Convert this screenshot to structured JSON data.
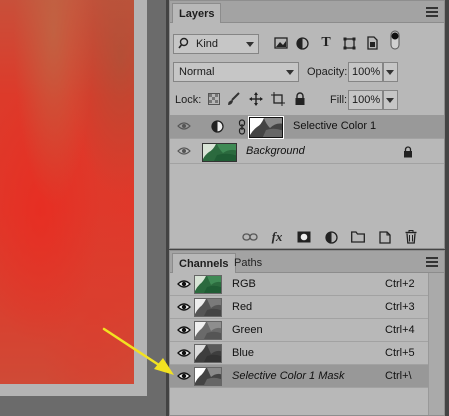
{
  "layers_panel": {
    "tab": "Layers",
    "filter_kind": "Kind",
    "blend_mode": "Normal",
    "opacity_label": "Opacity:",
    "opacity_value": "100%",
    "lock_label": "Lock:",
    "fill_label": "Fill:",
    "fill_value": "100%",
    "layers": [
      {
        "name": "Selective Color 1",
        "selected": true
      },
      {
        "name": "Background",
        "selected": false,
        "locked": true
      }
    ]
  },
  "channels_panel": {
    "tabs": [
      "Channels",
      "Paths"
    ],
    "channels": [
      {
        "name": "RGB",
        "shortcut": "Ctrl+2"
      },
      {
        "name": "Red",
        "shortcut": "Ctrl+3"
      },
      {
        "name": "Green",
        "shortcut": "Ctrl+4"
      },
      {
        "name": "Blue",
        "shortcut": "Ctrl+5"
      },
      {
        "name": "Selective Color 1 Mask",
        "shortcut": "Ctrl+\\",
        "selected": true
      }
    ]
  },
  "colors": {
    "panel_bg": "#b8b8b8",
    "selected_row": "#999999",
    "arrow": "#f2e221",
    "canvas_red": "#e0382a"
  },
  "icons": [
    "search-icon",
    "pixel-filter-icon",
    "adjustment-filter-icon",
    "type-filter-icon",
    "shape-filter-icon",
    "smart-object-filter-icon",
    "filter-toggle-icon",
    "lock-pixels-icon",
    "lock-paint-icon",
    "lock-position-icon",
    "lock-artboard-icon",
    "lock-all-icon",
    "eye-icon",
    "adjustment-layer-icon",
    "chain-link-icon",
    "lock-icon",
    "link-layers-icon",
    "fx-icon",
    "add-mask-icon",
    "new-adjustment-icon",
    "new-group-icon",
    "new-layer-icon",
    "trash-icon",
    "panel-menu-icon",
    "arrow-annotation"
  ]
}
